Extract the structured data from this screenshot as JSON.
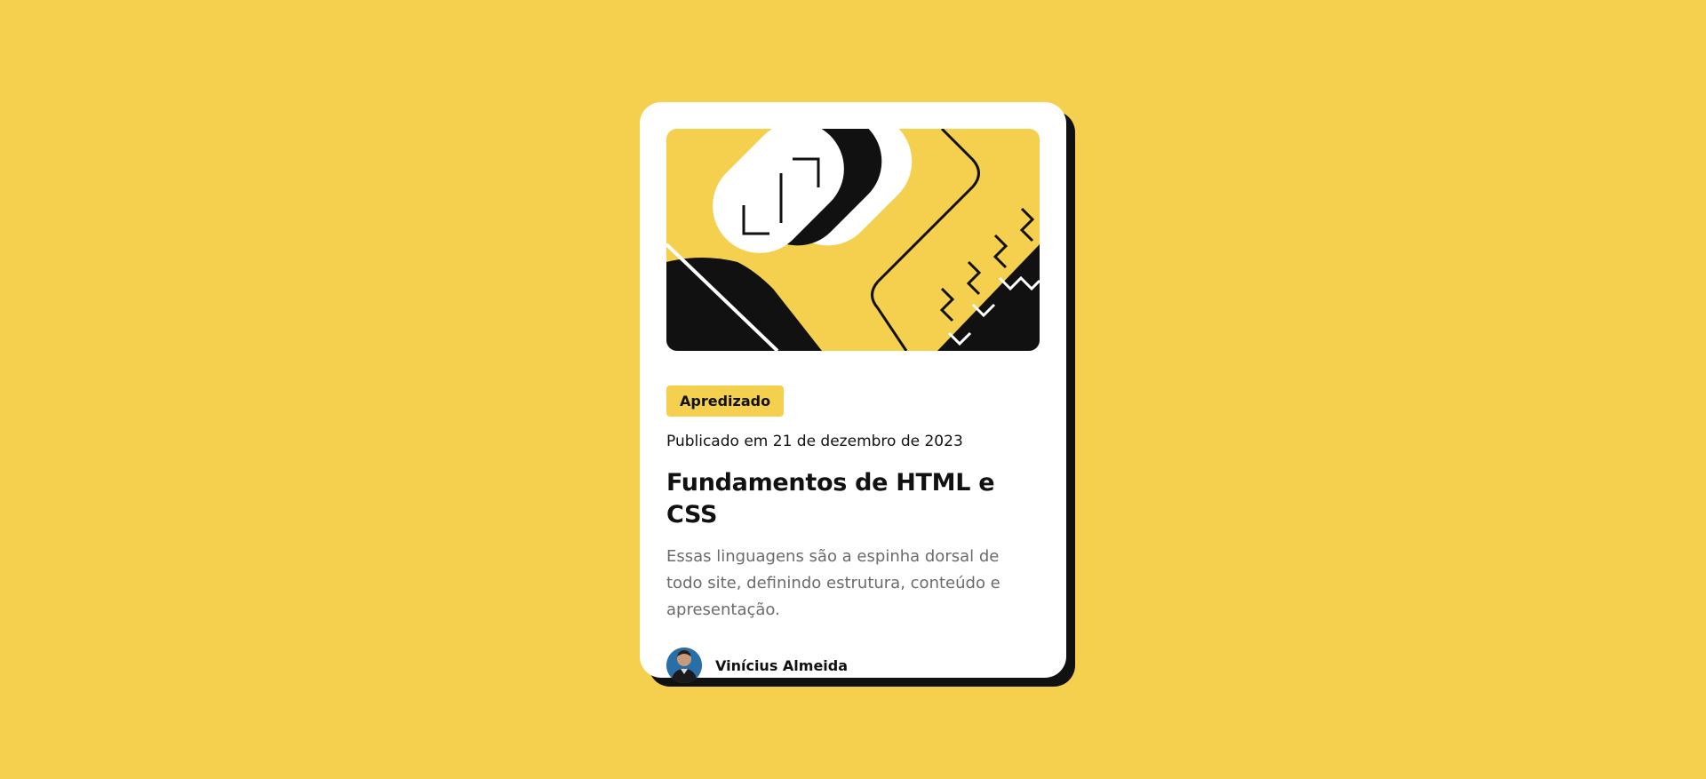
{
  "card": {
    "tag_label": "Apredizado",
    "published": "Publicado em 21 de dezembro de 2023",
    "title": "Fundamentos de HTML e CSS",
    "description": "Essas linguagens são a espinha dorsal de todo site, definindo estrutura, conteúdo e apresentação.",
    "author_name": "Vinícius Almeida"
  },
  "colors": {
    "background": "#f4d04e",
    "card": "#ffffff",
    "ink": "#111111",
    "muted_text": "#6b6b6b"
  },
  "icons": {
    "illustration": "abstract-illustration",
    "avatar": "author-avatar"
  }
}
